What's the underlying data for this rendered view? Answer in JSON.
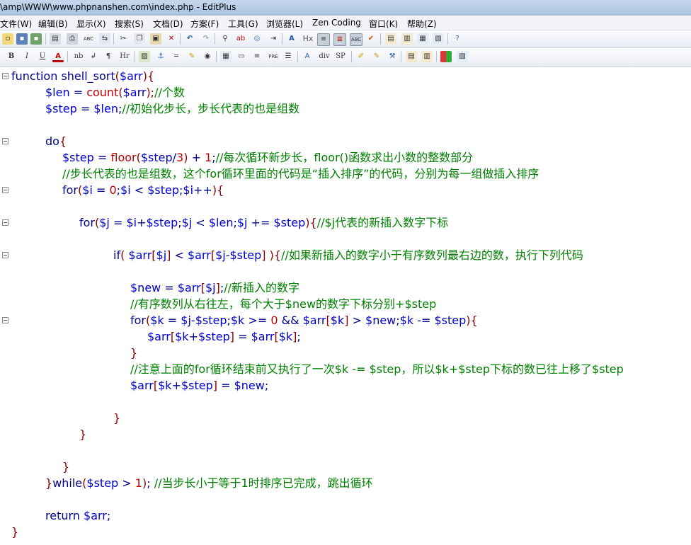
{
  "window": {
    "title": "\\amp\\WWW\\www.phpnanshen.com\\index.php - EditPlus"
  },
  "menu": [
    "文件(W)",
    "编辑(B)",
    "显示(X)",
    "搜索(S)",
    "文档(D)",
    "方案(F)",
    "工具(G)",
    "浏览器(L)",
    "Zen Coding",
    "窗口(K)",
    "帮助(Z)"
  ],
  "toolbar1": {
    "icons": [
      "new-file-icon",
      "save-icon",
      "save-all-icon",
      "print-preview-icon",
      "print-icon",
      "spell-check-icon",
      "convert-icon",
      "cut-icon",
      "copy-icon",
      "paste-icon",
      "delete-icon",
      "undo-icon",
      "redo-icon",
      "find-icon",
      "replace-icon",
      "browser-icon",
      "indent-icon",
      "font-size-icon",
      "heading-icon",
      "word-wrap-icon",
      "line-number-icon",
      "column-select-icon",
      "check-icon",
      "doc-window-icon",
      "cliptext-icon",
      "file-browser-icon",
      "output-window-icon",
      "help-icon"
    ],
    "labels": {
      "hx": "Hx",
      "abc": "ABC"
    }
  },
  "toolbar2": {
    "labels": {
      "bold": "B",
      "italic": "I",
      "underline": "U",
      "font_color": "A",
      "nbsp": "nb",
      "br": "↲",
      "para": "¶",
      "hr": "Hr",
      "pre": "PRE",
      "div": "div",
      "span": "SP"
    }
  },
  "code": {
    "lines": [
      [
        [
          "k",
          "function "
        ],
        [
          "k",
          "shell_sort"
        ],
        [
          "p",
          "("
        ],
        [
          "v",
          "$arr"
        ],
        [
          "p",
          "){"
        ]
      ],
      [
        [
          "v",
          "$len"
        ],
        [
          "o",
          " = "
        ],
        [
          "f",
          "count"
        ],
        [
          "p",
          "("
        ],
        [
          "v",
          "$arr"
        ],
        [
          "p",
          ");"
        ],
        [
          "c",
          "//个数"
        ]
      ],
      [
        [
          "v",
          "$step"
        ],
        [
          "o",
          " = "
        ],
        [
          "v",
          "$len"
        ],
        [
          "o",
          ";"
        ],
        [
          "c",
          "//初始化步长，步长代表的也是组数"
        ]
      ],
      [],
      [
        [
          "k",
          "do"
        ],
        [
          "p",
          "{"
        ]
      ],
      [
        [
          "v",
          "$step"
        ],
        [
          "o",
          " = "
        ],
        [
          "f",
          "floor"
        ],
        [
          "p",
          "("
        ],
        [
          "v",
          "$step"
        ],
        [
          "o",
          "/"
        ],
        [
          "n",
          "3"
        ],
        [
          "p",
          ")"
        ],
        [
          "o",
          " + "
        ],
        [
          "n",
          "1"
        ],
        [
          "o",
          ";"
        ],
        [
          "c",
          "//每次循环新步长，floor()函数求出小数的整数部分"
        ]
      ],
      [
        [
          "c",
          "//步长代表的也是组数，这个for循环里面的代码是“插入排序”的代码，分别为每一组做插入排序"
        ]
      ],
      [
        [
          "k",
          "for"
        ],
        [
          "p",
          "("
        ],
        [
          "v",
          "$i"
        ],
        [
          "o",
          " = "
        ],
        [
          "n",
          "0"
        ],
        [
          "o",
          ";"
        ],
        [
          "v",
          "$i"
        ],
        [
          "o",
          " < "
        ],
        [
          "v",
          "$step"
        ],
        [
          "o",
          ";"
        ],
        [
          "v",
          "$i"
        ],
        [
          "o",
          "++"
        ],
        [
          "p",
          "){"
        ]
      ],
      [],
      [
        [
          "k",
          "for"
        ],
        [
          "p",
          "("
        ],
        [
          "v",
          "$j"
        ],
        [
          "o",
          " = "
        ],
        [
          "v",
          "$i"
        ],
        [
          "o",
          "+"
        ],
        [
          "v",
          "$step"
        ],
        [
          "o",
          ";"
        ],
        [
          "v",
          "$j"
        ],
        [
          "o",
          " < "
        ],
        [
          "v",
          "$len"
        ],
        [
          "o",
          ";"
        ],
        [
          "v",
          "$j"
        ],
        [
          "o",
          " += "
        ],
        [
          "v",
          "$step"
        ],
        [
          "p",
          "){"
        ],
        [
          "c",
          "//$j代表的新插入数字下标"
        ]
      ],
      [],
      [
        [
          "k",
          "if"
        ],
        [
          "p",
          "( "
        ],
        [
          "v",
          "$arr"
        ],
        [
          "p",
          "["
        ],
        [
          "v",
          "$j"
        ],
        [
          "p",
          "]"
        ],
        [
          "o",
          " < "
        ],
        [
          "v",
          "$arr"
        ],
        [
          "p",
          "["
        ],
        [
          "v",
          "$j"
        ],
        [
          "o",
          "-"
        ],
        [
          "v",
          "$step"
        ],
        [
          "p",
          "]"
        ],
        [
          "p",
          " ){"
        ],
        [
          "c",
          "//如果新插入的数字小于有序数列最右边的数，执行下列代码"
        ]
      ],
      [],
      [
        [
          "v",
          "$new"
        ],
        [
          "o",
          " = "
        ],
        [
          "v",
          "$arr"
        ],
        [
          "p",
          "["
        ],
        [
          "v",
          "$j"
        ],
        [
          "p",
          "]"
        ],
        [
          "o",
          ";"
        ],
        [
          "c",
          "//新插入的数字"
        ]
      ],
      [
        [
          "c",
          "//有序数列从右往左，每个大于$new的数字下标分别+$step"
        ]
      ],
      [
        [
          "k",
          "for"
        ],
        [
          "p",
          "("
        ],
        [
          "v",
          "$k"
        ],
        [
          "o",
          " = "
        ],
        [
          "v",
          "$j"
        ],
        [
          "o",
          "-"
        ],
        [
          "v",
          "$step"
        ],
        [
          "o",
          ";"
        ],
        [
          "v",
          "$k"
        ],
        [
          "o",
          " >= "
        ],
        [
          "n",
          "0"
        ],
        [
          "o",
          " && "
        ],
        [
          "v",
          "$arr"
        ],
        [
          "p",
          "["
        ],
        [
          "v",
          "$k"
        ],
        [
          "p",
          "]"
        ],
        [
          "o",
          " > "
        ],
        [
          "v",
          "$new"
        ],
        [
          "o",
          ";"
        ],
        [
          "v",
          "$k"
        ],
        [
          "o",
          " -= "
        ],
        [
          "v",
          "$step"
        ],
        [
          "p",
          "){"
        ]
      ],
      [
        [
          "v",
          "$arr"
        ],
        [
          "p",
          "["
        ],
        [
          "v",
          "$k"
        ],
        [
          "o",
          "+"
        ],
        [
          "v",
          "$step"
        ],
        [
          "p",
          "]"
        ],
        [
          "o",
          " = "
        ],
        [
          "v",
          "$arr"
        ],
        [
          "p",
          "["
        ],
        [
          "v",
          "$k"
        ],
        [
          "p",
          "]"
        ],
        [
          "o",
          ";"
        ]
      ],
      [
        [
          "p",
          "}"
        ]
      ],
      [
        [
          "c",
          "//注意上面的for循环结束前又执行了一次$k -= $step，所以$k+$step下标的数已往上移了$step"
        ]
      ],
      [
        [
          "v",
          "$arr"
        ],
        [
          "p",
          "["
        ],
        [
          "v",
          "$k"
        ],
        [
          "o",
          "+"
        ],
        [
          "v",
          "$step"
        ],
        [
          "p",
          "]"
        ],
        [
          "o",
          " = "
        ],
        [
          "v",
          "$new"
        ],
        [
          "o",
          ";"
        ]
      ],
      [],
      [
        [
          "p",
          "}"
        ]
      ],
      [
        [
          "p",
          "}"
        ]
      ],
      [],
      [
        [
          "p",
          "}"
        ]
      ],
      [
        [
          "p",
          "}"
        ],
        [
          "k",
          "while"
        ],
        [
          "p",
          "("
        ],
        [
          "v",
          "$step"
        ],
        [
          "o",
          " > "
        ],
        [
          "n",
          "1"
        ],
        [
          "p",
          ")"
        ],
        [
          "o",
          "; "
        ],
        [
          "c",
          "//当步长小于等于1时排序已完成，跳出循环"
        ]
      ],
      [],
      [
        [
          "k",
          "return "
        ],
        [
          "v",
          "$arr"
        ],
        [
          "o",
          ";"
        ]
      ],
      [
        [
          "p",
          "}"
        ]
      ]
    ]
  }
}
